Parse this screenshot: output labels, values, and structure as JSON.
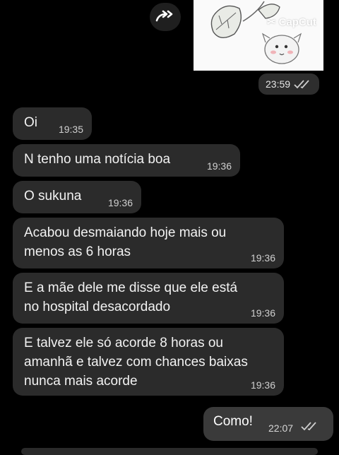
{
  "media": {
    "watermark": "CapCut",
    "timestamp": "23:59"
  },
  "messages": [
    {
      "text": "Oi",
      "time": "19:35"
    },
    {
      "text": "N tenho uma notícia boa",
      "time": "19:36"
    },
    {
      "text": "O sukuna",
      "time": "19:36"
    },
    {
      "text": "Acabou desmaiando hoje mais ou menos as 6 horas",
      "time": "19:36"
    },
    {
      "text": "E a mãe dele me disse que ele está no hospital desacordado",
      "time": "19:36"
    },
    {
      "text": "E talvez ele só acorde 8 horas ou amanhã e talvez com chances baixas nunca mais acorde",
      "time": "19:36"
    }
  ],
  "outgoing": {
    "text": "Como!",
    "time": "22:07"
  },
  "colors": {
    "bubble": "#2b2b2b",
    "background": "#000000",
    "ticks": "#cfcfcf"
  },
  "icons": {
    "forward": "forward-double-chevron-icon",
    "read_receipt": "double-check-icon"
  }
}
